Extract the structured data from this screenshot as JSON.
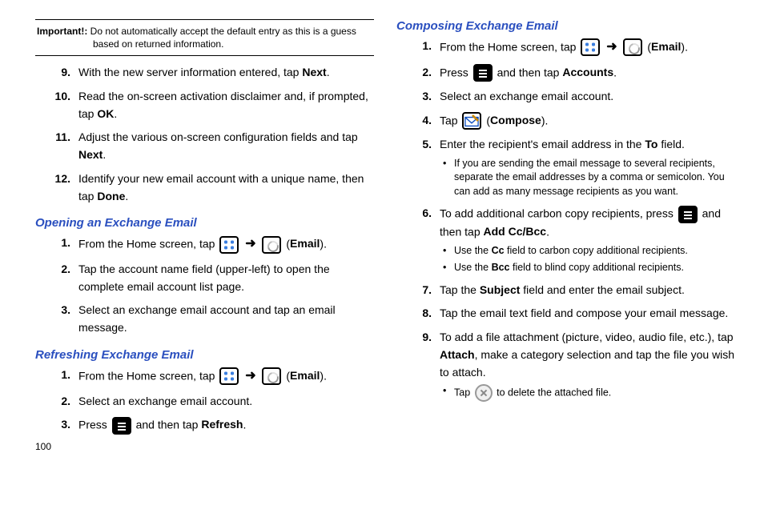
{
  "important": {
    "label": "Important!:",
    "text": " Do not automatically accept the default entry as this is a guess based on returned information."
  },
  "listA": {
    "i9a": "With the new server information entered, tap ",
    "i9b": "Next",
    "i9c": ".",
    "i10a": "Read the on-screen activation disclaimer and, if prompted, tap ",
    "i10b": "OK",
    "i10c": ".",
    "i11a": "Adjust the various on-screen configuration fields and tap ",
    "i11b": "Next",
    "i11c": ".",
    "i12a": "Identify your new email account with a unique name, then tap ",
    "i12b": "Done",
    "i12c": "."
  },
  "headings": {
    "opening": "Opening an Exchange Email",
    "refreshing": "Refreshing Exchange Email",
    "composing": "Composing Exchange Email"
  },
  "open": {
    "s1a": "From the Home screen, tap ",
    "s1b": " (",
    "s1c": "Email",
    "s1d": ").",
    "s2": "Tap the account name field (upper-left) to open the complete email account list page.",
    "s3": "Select an exchange email account and tap an email message."
  },
  "refresh": {
    "s1a": "From the Home screen, tap ",
    "s1b": " (",
    "s1c": "Email",
    "s1d": ").",
    "s2": "Select an exchange email account.",
    "s3a": "Press ",
    "s3b": " and then tap ",
    "s3c": "Refresh",
    "s3d": "."
  },
  "compose": {
    "s1a": "From the Home screen, tap ",
    "s1b": " (",
    "s1c": "Email",
    "s1d": ").",
    "s2a": "Press ",
    "s2b": " and then tap ",
    "s2c": "Accounts",
    "s2d": ".",
    "s3": "Select an exchange email account.",
    "s4a": "Tap ",
    "s4b": " (",
    "s4c": "Compose",
    "s4d": ").",
    "s5a": "Enter the recipient's email address in the ",
    "s5b": "To",
    "s5c": " field.",
    "b5": "If you are sending the email message to several recipients, separate the email addresses by a comma or semicolon. You can add as many message recipients as you want.",
    "s6a": "To add additional carbon copy recipients, press ",
    "s6b": " and then tap ",
    "s6c": "Add Cc/Bcc",
    "s6d": ".",
    "b6a_a": "Use the ",
    "b6a_b": "Cc",
    "b6a_c": " field to carbon copy additional recipients.",
    "b6b_a": "Use the ",
    "b6b_b": "Bcc",
    "b6b_c": " field to blind copy additional recipients.",
    "s7a": "Tap the ",
    "s7b": "Subject",
    "s7c": " field and enter the email subject.",
    "s8": "Tap the email text field and compose your email message.",
    "s9a": "To add a file attachment (picture, video, audio file, etc.), tap ",
    "s9b": "Attach",
    "s9c": ", make a category selection and tap the file you wish to attach.",
    "b9a": "Tap ",
    "b9b": " to delete the attached file."
  },
  "pageNumber": "100",
  "arrow": "➜"
}
